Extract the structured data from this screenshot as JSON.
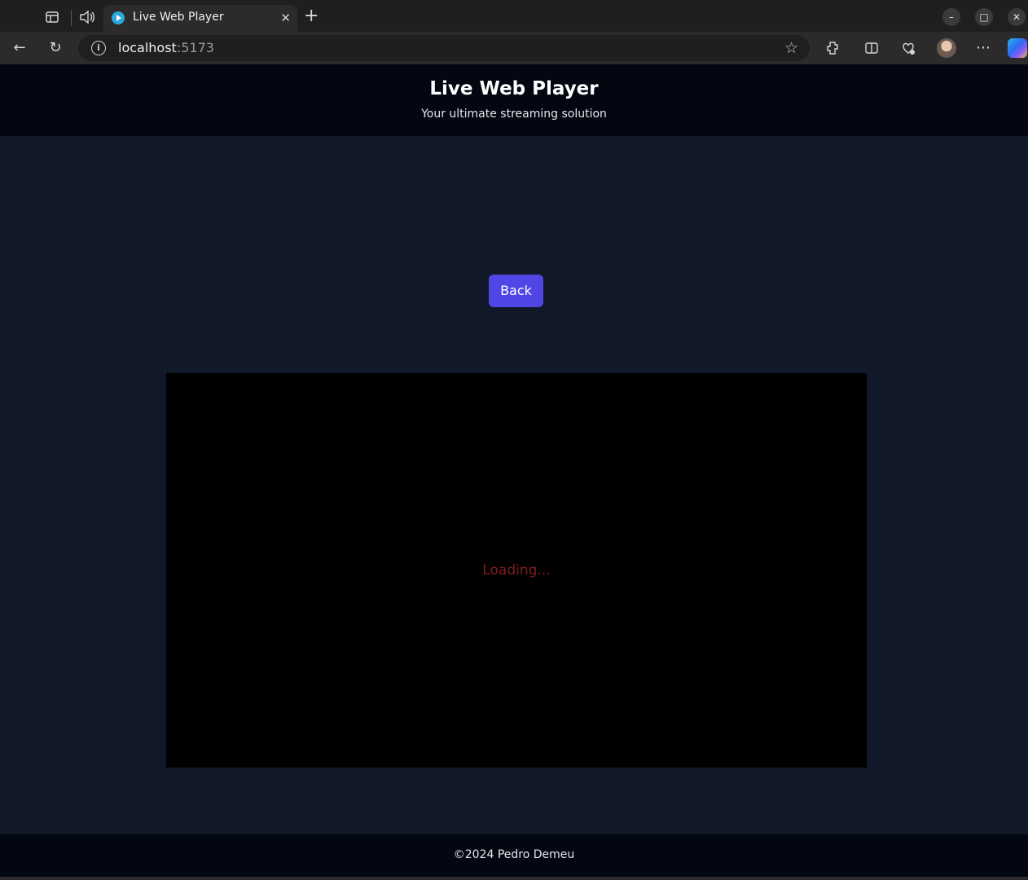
{
  "browser": {
    "tab_title": "Live Web Player",
    "url_host": "localhost",
    "url_port": ":5173"
  },
  "header": {
    "title": "Live Web Player",
    "subtitle": "Your ultimate streaming solution"
  },
  "main": {
    "back_label": "Back",
    "loading_text": "Loading..."
  },
  "footer": {
    "text": "©2024 Pedro Demeu"
  },
  "colors": {
    "page_bg": "#111827",
    "header_bg": "#030712",
    "button_bg": "#4f46e5",
    "loading_text": "#7f1d1d"
  }
}
